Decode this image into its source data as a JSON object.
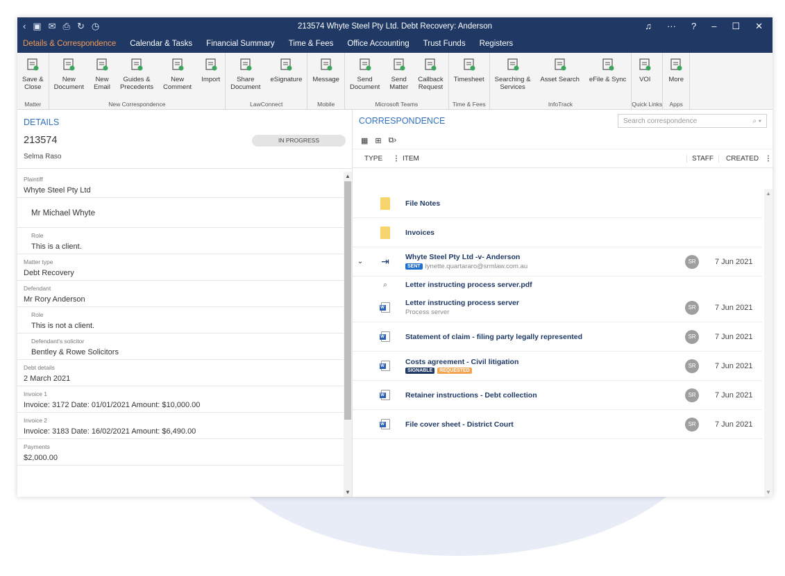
{
  "window": {
    "title": "213574 Whyte Steel Pty Ltd. Debt Recovery: Anderson"
  },
  "tabs": [
    {
      "label": "Details & Correspondence",
      "active": true
    },
    {
      "label": "Calendar & Tasks"
    },
    {
      "label": "Financial Summary"
    },
    {
      "label": "Time & Fees"
    },
    {
      "label": "Office Accounting"
    },
    {
      "label": "Trust Funds"
    },
    {
      "label": "Registers"
    }
  ],
  "ribbon": {
    "groups": [
      {
        "label": "Matter",
        "buttons": [
          {
            "label": "Save &\nClose",
            "icon": "save-close-icon"
          }
        ]
      },
      {
        "label": "New Correspondence",
        "buttons": [
          {
            "label": "New\nDocument",
            "icon": "new-document-icon"
          },
          {
            "label": "New\nEmail",
            "icon": "new-email-icon"
          },
          {
            "label": "Guides &\nPrecedents",
            "icon": "guides-icon"
          },
          {
            "label": "New\nComment",
            "icon": "new-comment-icon"
          },
          {
            "label": "Import",
            "icon": "import-icon"
          }
        ]
      },
      {
        "label": "LawConnect",
        "buttons": [
          {
            "label": "Share\nDocument",
            "icon": "share-document-icon"
          },
          {
            "label": "eSignature",
            "icon": "esignature-icon"
          }
        ]
      },
      {
        "label": "Mobile",
        "buttons": [
          {
            "label": "Message",
            "icon": "message-icon"
          }
        ]
      },
      {
        "label": "Microsoft Teams",
        "buttons": [
          {
            "label": "Send\nDocument",
            "icon": "send-document-icon"
          },
          {
            "label": "Send\nMatter",
            "icon": "send-matter-icon"
          },
          {
            "label": "Callback\nRequest",
            "icon": "callback-icon"
          }
        ]
      },
      {
        "label": "Time & Fees",
        "buttons": [
          {
            "label": "Timesheet",
            "icon": "timesheet-icon"
          }
        ]
      },
      {
        "label": "InfoTrack",
        "buttons": [
          {
            "label": "Searching &\nServices",
            "icon": "searching-icon"
          },
          {
            "label": "Asset Search",
            "icon": "asset-search-icon"
          },
          {
            "label": "eFile & Sync",
            "icon": "efile-icon"
          }
        ]
      },
      {
        "label": "Quick Links",
        "buttons": [
          {
            "label": "VOI",
            "icon": "voi-icon"
          }
        ]
      },
      {
        "label": "Apps",
        "buttons": [
          {
            "label": "More",
            "icon": "more-apps-icon"
          }
        ]
      }
    ]
  },
  "details": {
    "heading": "DETAILS",
    "matter_id": "213574",
    "status": "IN PROGRESS",
    "staff": "Selma Raso",
    "fields": [
      {
        "label": "Plaintiff",
        "value": "Whyte Steel Pty Ltd"
      },
      {
        "label": "",
        "value": "Mr Michael Whyte",
        "big": true
      },
      {
        "label": "Role",
        "value": "This is a client.",
        "indent": true
      },
      {
        "label": "Matter type",
        "value": "Debt Recovery"
      },
      {
        "label": "Defendant",
        "value": "Mr Rory Anderson"
      },
      {
        "label": "Role",
        "value": "This is not a client.",
        "indent": true
      },
      {
        "label": "Defendant's solicitor",
        "value": "Bentley & Rowe Solicitors",
        "indent": true
      },
      {
        "label": "Debt details",
        "value": "2 March 2021"
      },
      {
        "label": "Invoice 1",
        "value": "Invoice: 3172 Date: 01/01/2021 Amount: $10,000.00"
      },
      {
        "label": "Invoice 2",
        "value": "Invoice: 3183 Date: 16/02/2021 Amount: $6,490.00"
      },
      {
        "label": "Payments",
        "value": "$2,000.00"
      }
    ]
  },
  "correspondence": {
    "heading": "CORRESPONDENCE",
    "search_placeholder": "Search correspondence",
    "columns": {
      "type": "TYPE",
      "item": "ITEM",
      "staff": "STAFF",
      "created": "CREATED"
    },
    "rows": [
      {
        "kind": "folder",
        "title": "File Notes"
      },
      {
        "kind": "folder",
        "title": "Invoices"
      },
      {
        "kind": "email",
        "title": "Whyte Steel Pty Ltd -v- Anderson",
        "badge": "SENT",
        "sub": "lynette.quartararo@srmlaw.com.au",
        "staff": "SR",
        "date": "7 Jun 2021",
        "expanded": true
      },
      {
        "kind": "attachment",
        "title": "Letter instructing process server.pdf"
      },
      {
        "kind": "word",
        "title": "Letter instructing process server",
        "sub": "Process server",
        "staff": "SR",
        "date": "7 Jun 2021"
      },
      {
        "kind": "word",
        "title": "Statement of claim - filing party legally represented",
        "staff": "SR",
        "date": "7 Jun 2021"
      },
      {
        "kind": "word",
        "title": "Costs agreement - Civil litigation",
        "badge": "SIGNABLE",
        "badge2": "REQUESTED",
        "staff": "SR",
        "date": "7 Jun 2021"
      },
      {
        "kind": "word",
        "title": "Retainer instructions - Debt collection",
        "staff": "SR",
        "date": "7 Jun 2021"
      },
      {
        "kind": "word",
        "title": "File cover sheet - District Court",
        "staff": "SR",
        "date": "7 Jun 2021"
      }
    ]
  },
  "colors": {
    "navy": "#1f3864",
    "accent": "#f39c5a",
    "link": "#2f6fc0"
  }
}
